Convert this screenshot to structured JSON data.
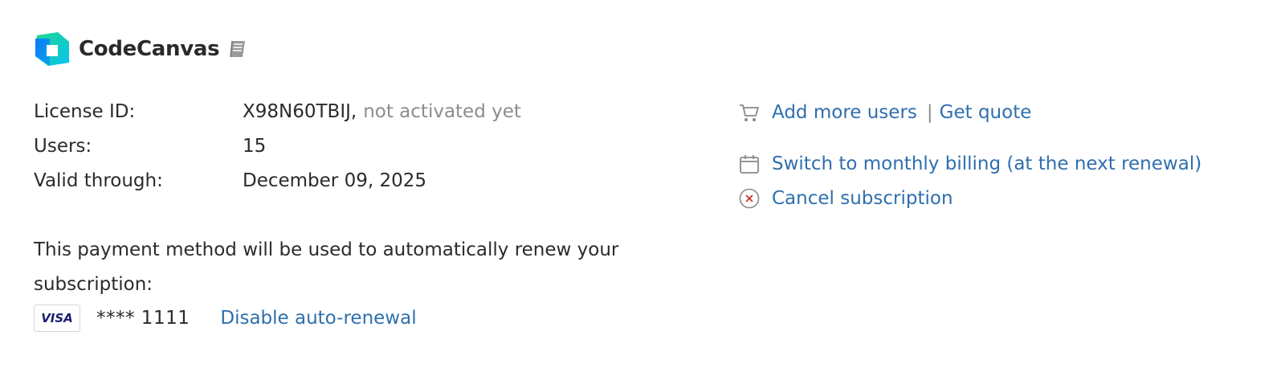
{
  "header": {
    "product_name": "CodeCanvas",
    "logo_icon": "codecanvas-logo-icon",
    "docs_icon": "book-icon"
  },
  "license": {
    "rows": [
      {
        "label": "License ID:",
        "value": "X98N60TBIJ,",
        "note": "not activated yet"
      },
      {
        "label": "Users:",
        "value": "15"
      },
      {
        "label": "Valid through:",
        "value": "December 09, 2025"
      }
    ]
  },
  "payment": {
    "text": "This payment method will be used to automatically renew your subscription:",
    "card_brand": "VISA",
    "card_number": "**** 1111",
    "disable_link": "Disable auto-renewal"
  },
  "actions": {
    "add_users": "Add more users",
    "separator": "|",
    "get_quote": "Get quote",
    "switch_billing": "Switch to monthly billing (at the next renewal)",
    "cancel": "Cancel subscription"
  },
  "colors": {
    "link": "#2f6fae",
    "muted": "#8c8c8c",
    "cancel_icon": "#d0342c",
    "visa": "#1a1f71"
  }
}
